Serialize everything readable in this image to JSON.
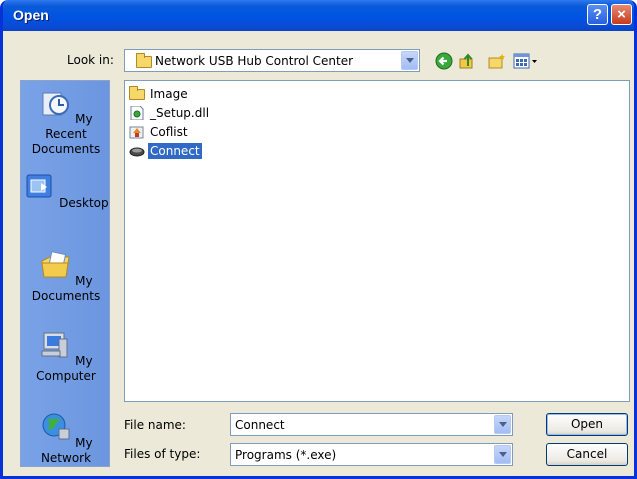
{
  "window": {
    "title": "Open",
    "help_label": "?",
    "close_label": "×"
  },
  "toolbar": {
    "look_in_label": "Look in:",
    "look_in_value": "Network USB Hub Control Center",
    "icons": [
      "back-icon",
      "up-folder-icon",
      "new-folder-icon",
      "views-menu-icon"
    ]
  },
  "places": [
    {
      "label": "My Recent Documents",
      "icon": "recent-documents-icon"
    },
    {
      "label": "Desktop",
      "icon": "desktop-icon"
    },
    {
      "label": "My Documents",
      "icon": "my-documents-icon"
    },
    {
      "label": "My Computer",
      "icon": "my-computer-icon"
    },
    {
      "label": "My Network",
      "icon": "my-network-icon"
    }
  ],
  "files": [
    {
      "name": "Image",
      "icon": "folder-icon",
      "selected": false
    },
    {
      "name": "_Setup.dll",
      "icon": "dll-file-icon",
      "selected": false
    },
    {
      "name": "Coflist",
      "icon": "program-icon",
      "selected": false
    },
    {
      "name": "Connect",
      "icon": "connect-program-icon",
      "selected": true
    }
  ],
  "filename": {
    "label": "File name:",
    "value": "Connect"
  },
  "filetype": {
    "label": "Files of type:",
    "value": "Programs (*.exe)"
  },
  "buttons": {
    "open": "Open",
    "cancel": "Cancel"
  },
  "colors": {
    "titlebar": "#0054e3",
    "window_border": "#0831d9",
    "selection": "#316ac5",
    "places_bar": "#6b96df"
  }
}
